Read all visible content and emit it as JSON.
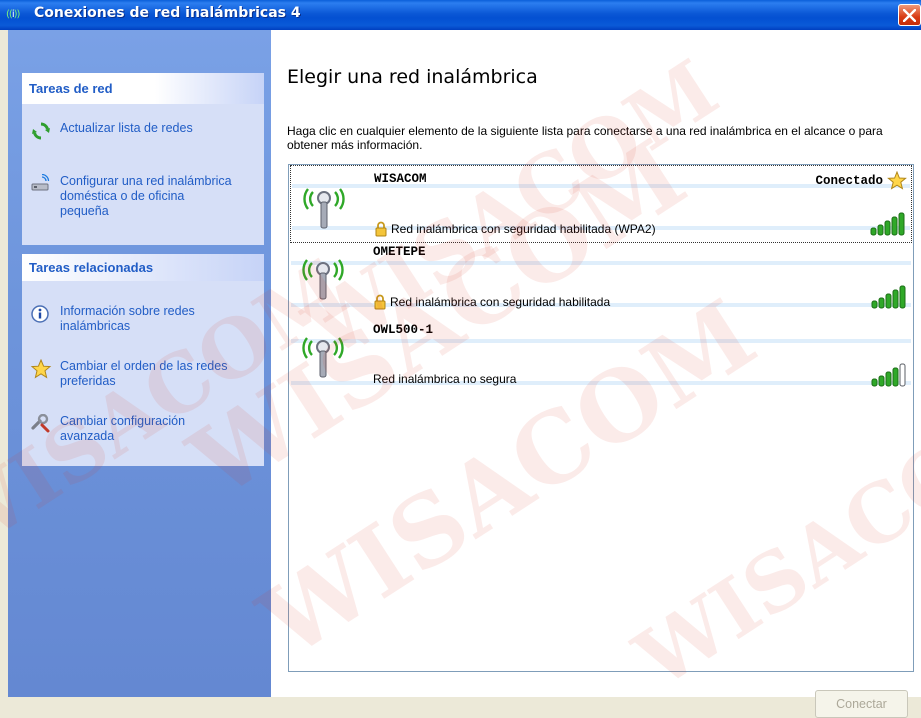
{
  "window": {
    "title": "Conexiones de red inalámbricas 4",
    "title_icon": "wireless-network-icon"
  },
  "sidebar": {
    "network_tasks": {
      "header": "Tareas de red",
      "items": [
        {
          "label": "Actualizar lista de redes",
          "icon": "refresh-icon"
        },
        {
          "label": "Configurar una red inalámbrica doméstica o de oficina pequeña",
          "icon": "setup-network-icon"
        }
      ]
    },
    "related_tasks": {
      "header": "Tareas relacionadas",
      "items": [
        {
          "label": "Información sobre redes inalámbricas",
          "icon": "info-icon"
        },
        {
          "label": "Cambiar el orden de las redes preferidas",
          "icon": "star-icon"
        },
        {
          "label": "Cambiar configuración avanzada",
          "icon": "settings-icon"
        }
      ]
    }
  },
  "main": {
    "heading": "Elegir una red inalámbrica",
    "description": "Haga clic en cualquier elemento de la siguiente lista para conectarse a una red inalámbrica en el alcance o para obtener más información.",
    "networks": [
      {
        "name": "WISACOM",
        "security": "Red inalámbrica con seguridad habilitada (WPA2)",
        "status": "Conectado",
        "secured": true,
        "signal_bars": 5,
        "selected": true
      },
      {
        "name": "OMETEPE",
        "security": "Red inalámbrica con seguridad habilitada",
        "status": "",
        "secured": true,
        "signal_bars": 5,
        "selected": false
      },
      {
        "name": "OWL500-1",
        "security": "Red inalámbrica no segura",
        "status": "",
        "secured": false,
        "signal_bars": 4,
        "selected": false
      }
    ],
    "connect_button": "Conectar"
  },
  "watermark": "WISACOM",
  "colors": {
    "titlebar": "#0a58d6",
    "task_link": "#215dc6",
    "signal_green": "#2fa828",
    "selection_stripe": "#dfeefb"
  }
}
